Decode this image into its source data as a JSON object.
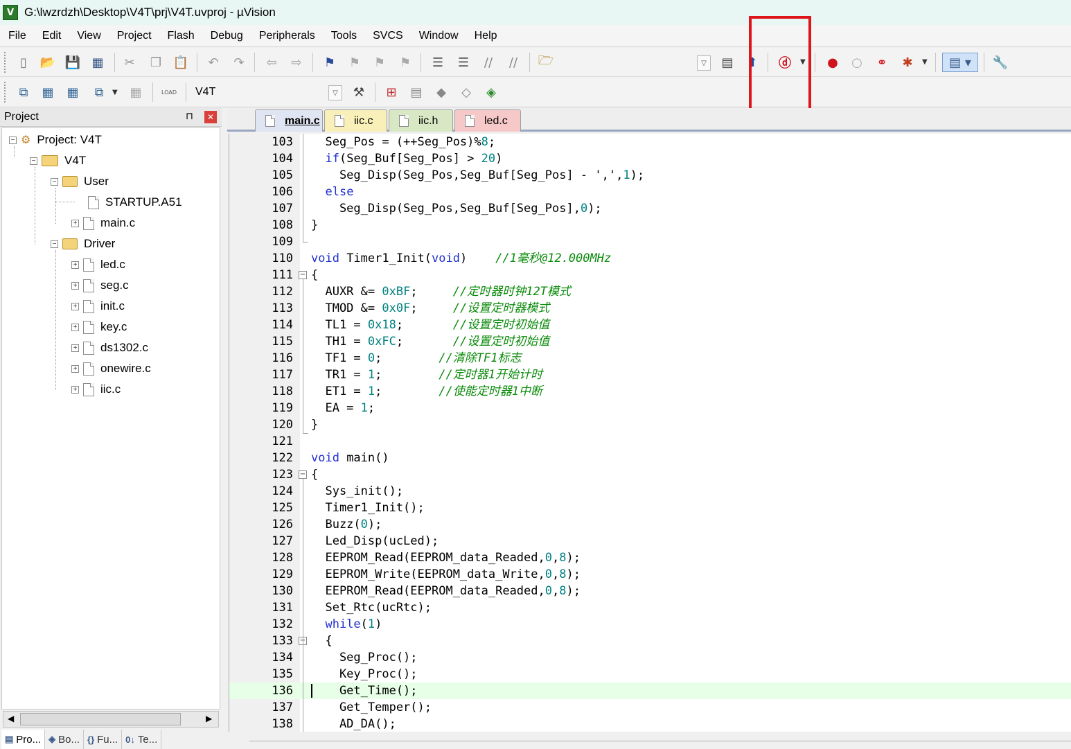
{
  "window": {
    "title": "G:\\lwzrdzh\\Desktop\\V4T\\prj\\V4T.uvproj - µVision",
    "app_icon": "V"
  },
  "menu": [
    "File",
    "Edit",
    "View",
    "Project",
    "Flash",
    "Debug",
    "Peripherals",
    "Tools",
    "SVCS",
    "Window",
    "Help"
  ],
  "toolbar2": {
    "load_label": "LOAD",
    "target": "V4T"
  },
  "project_panel": {
    "title": "Project",
    "pin": "⊓",
    "close": "✕",
    "tree": {
      "root": "Project: V4T",
      "target": "V4T",
      "groups": [
        {
          "name": "User",
          "files": [
            "STARTUP.A51",
            "main.c"
          ]
        },
        {
          "name": "Driver",
          "files": [
            "led.c",
            "seg.c",
            "init.c",
            "key.c",
            "ds1302.c",
            "onewire.c",
            "iic.c"
          ]
        }
      ]
    },
    "bottom_tabs": [
      {
        "icon": "▤",
        "label": "Pro..."
      },
      {
        "icon": "◈",
        "label": "Bo..."
      },
      {
        "icon": "{}",
        "label": "Fu..."
      },
      {
        "icon": "0↓",
        "label": "Te..."
      }
    ]
  },
  "editor": {
    "tabs": [
      {
        "label": "main.c",
        "color": "#dfe5f2",
        "active": true
      },
      {
        "label": "iic.c",
        "color": "#f8f0b8",
        "active": false
      },
      {
        "label": "iic.h",
        "color": "#d8e8c4",
        "active": false
      },
      {
        "label": "led.c",
        "color": "#f6c8c8",
        "active": false
      }
    ],
    "current_line": 136,
    "lines": [
      {
        "n": "103",
        "code": "  Seg_Pos = (++Seg_Pos)%8;"
      },
      {
        "n": "104",
        "code": "  if(Seg_Buf[Seg_Pos] > 20)"
      },
      {
        "n": "105",
        "code": "    Seg_Disp(Seg_Pos,Seg_Buf[Seg_Pos] - ',',1);"
      },
      {
        "n": "106",
        "code": "  else"
      },
      {
        "n": "107",
        "code": "    Seg_Disp(Seg_Pos,Seg_Buf[Seg_Pos],0);"
      },
      {
        "n": "108",
        "code": "}"
      },
      {
        "n": "109",
        "code": ""
      },
      {
        "n": "110",
        "code": "void Timer1_Init(void)    //1毫秒@12.000MHz"
      },
      {
        "n": "111",
        "code": "{"
      },
      {
        "n": "112",
        "code": "  AUXR &= 0xBF;     //定时器时钟12T模式"
      },
      {
        "n": "113",
        "code": "  TMOD &= 0x0F;     //设置定时器模式"
      },
      {
        "n": "114",
        "code": "  TL1 = 0x18;       //设置定时初始值"
      },
      {
        "n": "115",
        "code": "  TH1 = 0xFC;       //设置定时初始值"
      },
      {
        "n": "116",
        "code": "  TF1 = 0;        //清除TF1标志"
      },
      {
        "n": "117",
        "code": "  TR1 = 1;        //定时器1开始计时"
      },
      {
        "n": "118",
        "code": "  ET1 = 1;        //使能定时器1中断"
      },
      {
        "n": "119",
        "code": "  EA = 1;"
      },
      {
        "n": "120",
        "code": "}"
      },
      {
        "n": "121",
        "code": ""
      },
      {
        "n": "122",
        "code": "void main()"
      },
      {
        "n": "123",
        "code": "{"
      },
      {
        "n": "124",
        "code": "  Sys_init();"
      },
      {
        "n": "125",
        "code": "  Timer1_Init();"
      },
      {
        "n": "126",
        "code": "  Buzz(0);"
      },
      {
        "n": "127",
        "code": "  Led_Disp(ucLed);"
      },
      {
        "n": "128",
        "code": "  EEPROM_Read(EEPROM_data_Readed,0,8);"
      },
      {
        "n": "129",
        "code": "  EEPROM_Write(EEPROM_data_Write,0,8);"
      },
      {
        "n": "130",
        "code": "  EEPROM_Read(EEPROM_data_Readed,0,8);"
      },
      {
        "n": "131",
        "code": "  Set_Rtc(ucRtc);"
      },
      {
        "n": "132",
        "code": "  while(1)"
      },
      {
        "n": "133",
        "code": "  {"
      },
      {
        "n": "134",
        "code": "    Seg_Proc();"
      },
      {
        "n": "135",
        "code": "    Key_Proc();"
      },
      {
        "n": "136",
        "code": "    Get_Time();"
      },
      {
        "n": "137",
        "code": "    Get_Temper();"
      },
      {
        "n": "138",
        "code": "    AD_DA();"
      }
    ]
  },
  "colors": {
    "keyword": "#1f2fd0",
    "number": "#008080",
    "comment": "#0a8a0a",
    "highlight_box": "#e0141b",
    "current_line_bg": "#e6ffe6"
  }
}
